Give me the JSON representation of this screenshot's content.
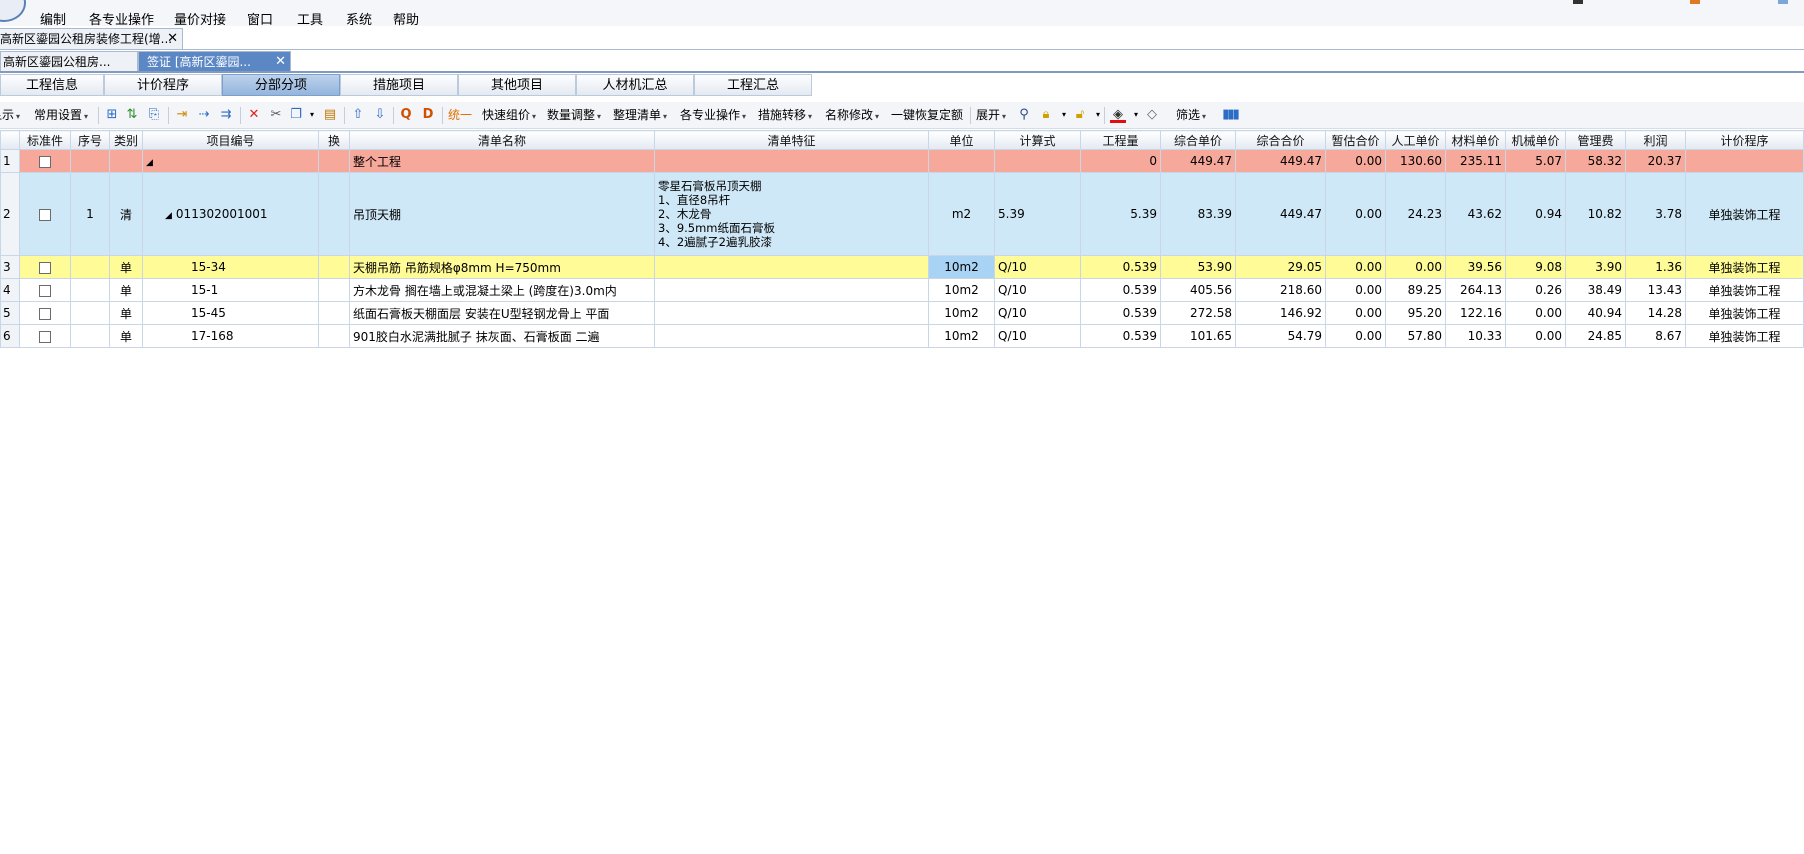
{
  "menu": [
    "编制",
    "各专业操作",
    "量价对接",
    "窗口",
    "工具",
    "系统",
    "帮助"
  ],
  "doc_tab": "高新区鎏园公租房装修工程(增...",
  "sub_tabs": [
    {
      "label": "高新区鎏园公租房...",
      "active": false
    },
    {
      "label": "签证 [高新区鎏园...",
      "active": true
    }
  ],
  "page_tabs": [
    {
      "label": "工程信息",
      "active": false
    },
    {
      "label": "计价程序",
      "active": false
    },
    {
      "label": "分部分项",
      "active": true
    },
    {
      "label": "措施项目",
      "active": false
    },
    {
      "label": "其他项目",
      "active": false
    },
    {
      "label": "人材机汇总",
      "active": false
    },
    {
      "label": "工程汇总",
      "active": false
    }
  ],
  "toolbar": {
    "show": "显示",
    "common_settings": "常用设置",
    "unify": "统一",
    "quick_group": "快速组价",
    "qty_adjust": "数量调整",
    "organize_list": "整理清单",
    "pro_ops": "各专业操作",
    "measure_transfer": "措施转移",
    "rename": "名称修改",
    "restore_quota": "一键恢复定额",
    "expand": "展开",
    "filter": "筛选"
  },
  "columns": [
    "",
    "标准件",
    "序号",
    "类别",
    "项目编号",
    "换",
    "清单名称",
    "清单特征",
    "单位",
    "计算式",
    "工程量",
    "综合单价",
    "综合合价",
    "暂估合价",
    "人工单价",
    "材料单价",
    "机械单价",
    "管理费",
    "利润",
    "计价程序"
  ],
  "rows": [
    {
      "rn": "1",
      "seq": "",
      "type": "",
      "code": "",
      "name": "整个工程",
      "feature": "",
      "unit": "",
      "formula": "",
      "qty": "0",
      "unit_price": "449.47",
      "total": "449.47",
      "est": "0.00",
      "labor": "130.60",
      "material": "235.11",
      "machine": "5.07",
      "mgmt": "58.32",
      "profit": "20.37",
      "program": ""
    },
    {
      "rn": "2",
      "seq": "1",
      "type": "清",
      "code": "011302001001",
      "name": "吊顶天棚",
      "feature": "零星石膏板吊顶天棚\n1、直径8吊杆\n2、木龙骨\n3、9.5mm纸面石膏板\n4、2遍腻子2遍乳胶漆",
      "unit": "m2",
      "formula": "5.39",
      "qty": "5.39",
      "unit_price": "83.39",
      "total": "449.47",
      "est": "0.00",
      "labor": "24.23",
      "material": "43.62",
      "machine": "0.94",
      "mgmt": "10.82",
      "profit": "3.78",
      "program": "单独装饰工程"
    },
    {
      "rn": "3",
      "seq": "",
      "type": "单",
      "code": "15-34",
      "name": "天棚吊筋 吊筋规格φ8mm H=750mm",
      "feature": "",
      "unit": "10m2",
      "formula": "Q/10",
      "qty": "0.539",
      "unit_price": "53.90",
      "total": "29.05",
      "est": "0.00",
      "labor": "0.00",
      "material": "39.56",
      "machine": "9.08",
      "mgmt": "3.90",
      "profit": "1.36",
      "program": "单独装饰工程"
    },
    {
      "rn": "4",
      "seq": "",
      "type": "单",
      "code": "15-1",
      "name": "方木龙骨 搁在墙上或混凝土梁上 (跨度在)3.0m内",
      "feature": "",
      "unit": "10m2",
      "formula": "Q/10",
      "qty": "0.539",
      "unit_price": "405.56",
      "total": "218.60",
      "est": "0.00",
      "labor": "89.25",
      "material": "264.13",
      "machine": "0.26",
      "mgmt": "38.49",
      "profit": "13.43",
      "program": "单独装饰工程"
    },
    {
      "rn": "5",
      "seq": "",
      "type": "单",
      "code": "15-45",
      "name": "纸面石膏板天棚面层 安装在U型轻钢龙骨上 平面",
      "feature": "",
      "unit": "10m2",
      "formula": "Q/10",
      "qty": "0.539",
      "unit_price": "272.58",
      "total": "146.92",
      "est": "0.00",
      "labor": "95.20",
      "material": "122.16",
      "machine": "0.00",
      "mgmt": "40.94",
      "profit": "14.28",
      "program": "单独装饰工程"
    },
    {
      "rn": "6",
      "seq": "",
      "type": "单",
      "code": "17-168",
      "name": "901胶白水泥满批腻子 抹灰面、石膏板面 二遍",
      "feature": "",
      "unit": "10m2",
      "formula": "Q/10",
      "qty": "0.539",
      "unit_price": "101.65",
      "total": "54.79",
      "est": "0.00",
      "labor": "57.80",
      "material": "10.33",
      "machine": "0.00",
      "mgmt": "24.85",
      "profit": "8.67",
      "program": "单独装饰工程"
    }
  ]
}
